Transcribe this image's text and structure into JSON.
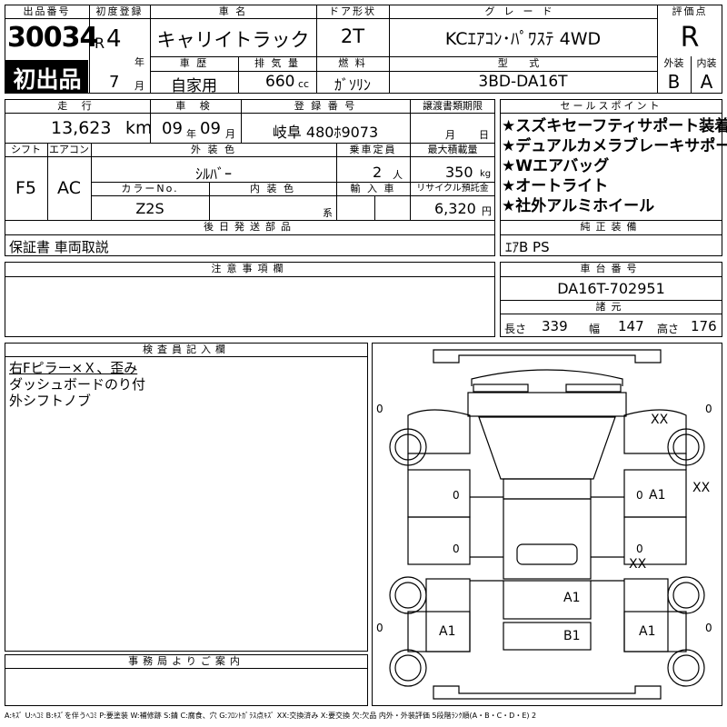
{
  "header": {
    "lot_no_label": "出品番号",
    "lot_no": "30034",
    "first_badge": "初出品",
    "first_reg_label": "初度登録",
    "era": "R",
    "year": "4",
    "year_unit": "年",
    "month": "7",
    "month_unit": "月",
    "car_name_label": "車 名",
    "car_name": "キャリイトラック",
    "door_label": "ドア形状",
    "door": "2T",
    "grade_label": "グレード",
    "grade": "KCｴｱｺﾝ･ﾊﾟﾜｽﾃ 4WD",
    "score_label": "評価点",
    "score": "R",
    "history_label": "車 歴",
    "history": "自家用",
    "displacement_label": "排 気 量",
    "displacement": "660",
    "displacement_unit": "cc",
    "fuel_label": "燃 料",
    "fuel": "ｶﾞｿﾘﾝ",
    "model_label": "型 式",
    "model": "3BD-DA16T",
    "exterior_label": "外装",
    "exterior": "B",
    "interior_label": "内装",
    "interior": "A"
  },
  "row2": {
    "mileage_label": "走 行",
    "mileage": "13,623",
    "mileage_unit": "km",
    "inspection_label": "車 検",
    "inspection_year": "09",
    "inspection_year_unit": "年",
    "inspection_month": "09",
    "inspection_month_unit": "月",
    "plate_label": "登 録 番 号",
    "plate": "岐阜 480ﾎ9073",
    "transfer_label": "譲渡書類期限",
    "transfer_month_unit": "月",
    "transfer_day_unit": "日",
    "shift_label": "シフト",
    "shift": "F5",
    "ac_label": "エアコン",
    "ac": "AC",
    "color_label": "外 装 色",
    "color": "ｼﾙﾊﾞｰ",
    "capacity_label": "乗車定員",
    "capacity": "2",
    "capacity_unit": "人",
    "load_label": "最大積載量",
    "load": "350",
    "load_unit": "kg",
    "colorno_label": "カラーNo.",
    "colorno": "Z2S",
    "interior_color_label": "内 装 色",
    "interior_color_unit": "系",
    "import_label": "輸 入 車",
    "recycle_label": "リサイクル預託金",
    "recycle": "6,320",
    "recycle_unit": "円"
  },
  "sales_points": {
    "label": "セールスポイント",
    "items": [
      "★スズキセーフティサポート装着車",
      "★デュアルカメラブレーキサポート",
      "★Wエアバッグ",
      "★オートライト",
      "★社外アルミホイール"
    ]
  },
  "later_parts": {
    "label": "後日発送部品",
    "text": "保証書 車両取説"
  },
  "genuine": {
    "label": "純正装備",
    "text": "ｴｱB PS"
  },
  "notes": {
    "label": "注意事項欄",
    "text": ""
  },
  "chassis": {
    "label": "車台番号",
    "number": "DA16T-702951"
  },
  "dimensions": {
    "label": "諸元",
    "length_label": "長さ",
    "length": "339",
    "width_label": "幅",
    "width": "147",
    "height_label": "高さ",
    "height": "176"
  },
  "inspector": {
    "label": "検査員記入欄",
    "lines": [
      "右Fピラー×Ｘ、歪み",
      "ダッシュボードのり付",
      "外シフトノブ"
    ]
  },
  "office": {
    "label": "事務局よりご案内",
    "text": ""
  },
  "diagram_marks": {
    "m1": "XX",
    "m2": "A1",
    "m3": "XX",
    "m4": "XX",
    "m5": "A1",
    "m6": "A1",
    "m7": "A1",
    "m8": "B1",
    "m9": "0",
    "m10": "0",
    "m11": "0",
    "m12": "0",
    "m13": "0",
    "m14": "0",
    "m15": "0",
    "m16": "0",
    "bracket": "[ ]"
  },
  "legend": "A:ｷｽﾞ U:ﾍｺﾐ B:ｷｽﾞを伴うﾍｺﾐ P:要塗装 W:補修跡 S:錆 C:腐食、穴 G:ﾌﾛﾝﾄｶﾞﾗｽ点ｷｽﾞ XX:交換済み X:要交換 欠:欠品 内外・外装評価 5段階ﾗﾝｸ順(A・B・C・D・E) 2"
}
